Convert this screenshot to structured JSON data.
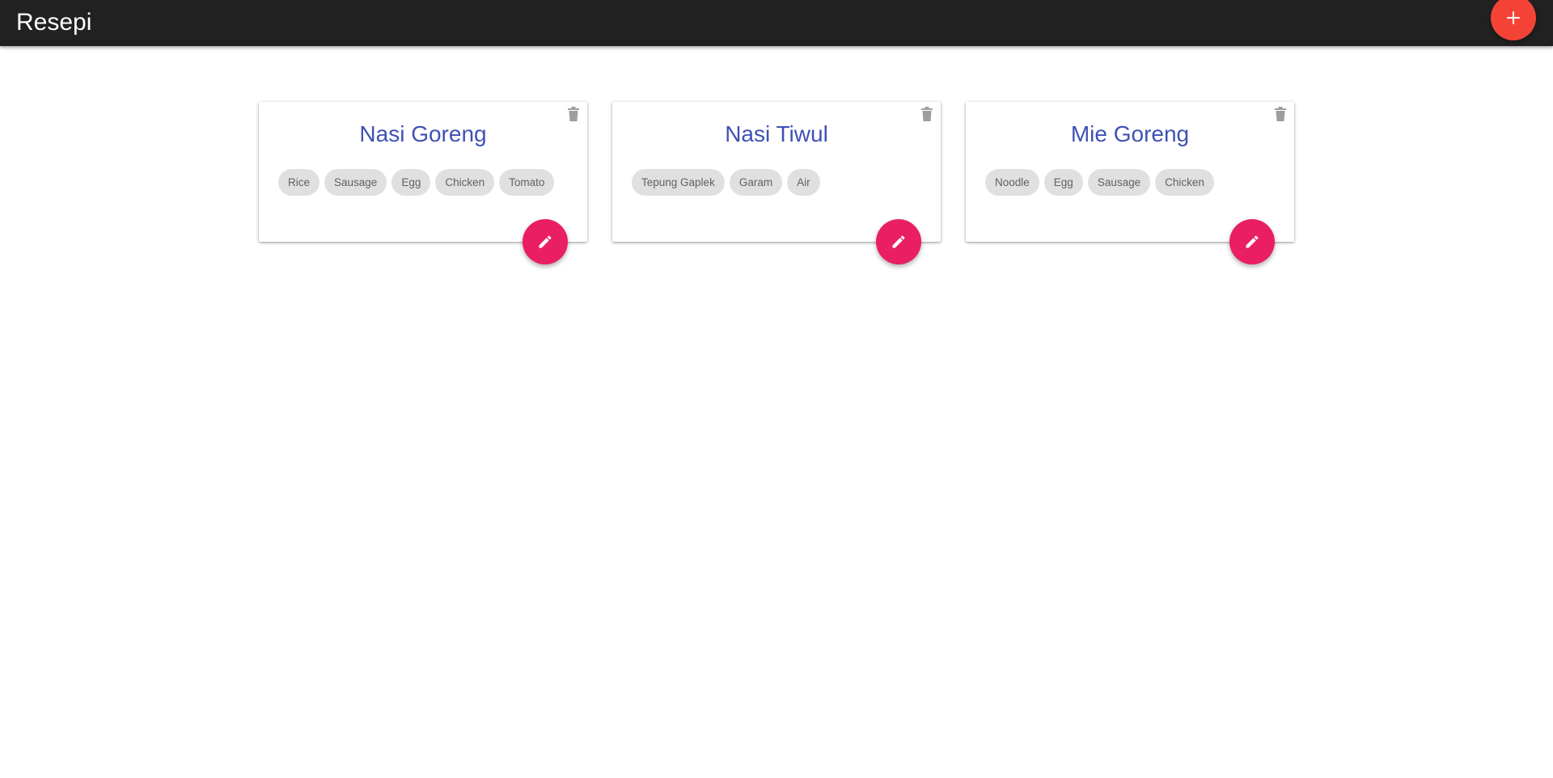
{
  "app": {
    "title": "Resepi",
    "add_button_icon": "plus-icon"
  },
  "colors": {
    "app_bar": "#212121",
    "add_fab": "#f44336",
    "edit_fab": "#e91e63",
    "card_title": "#3f51b5",
    "chip_bg": "#e0e0e0",
    "chip_text": "#616161",
    "delete_icon": "#9e9e9e"
  },
  "recipes": [
    {
      "title": "Nasi Goreng",
      "ingredients": [
        "Rice",
        "Sausage",
        "Egg",
        "Chicken",
        "Tomato"
      ],
      "delete_icon": "trash-icon",
      "edit_icon": "pencil-icon"
    },
    {
      "title": "Nasi Tiwul",
      "ingredients": [
        "Tepung Gaplek",
        "Garam",
        "Air"
      ],
      "delete_icon": "trash-icon",
      "edit_icon": "pencil-icon"
    },
    {
      "title": "Mie Goreng",
      "ingredients": [
        "Noodle",
        "Egg",
        "Sausage",
        "Chicken"
      ],
      "delete_icon": "trash-icon",
      "edit_icon": "pencil-icon"
    }
  ]
}
